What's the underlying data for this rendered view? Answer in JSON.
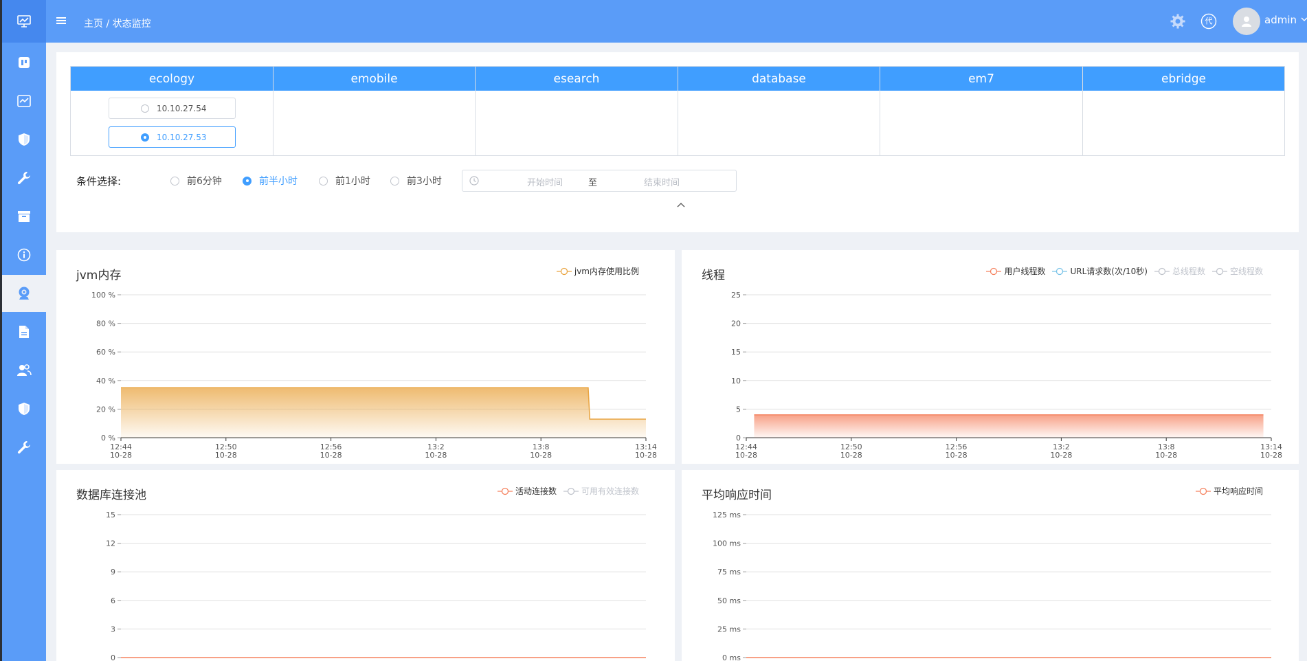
{
  "header": {
    "breadcrumb": "主页 / 状态监控",
    "username": "admin",
    "proxy_icon_text": "代"
  },
  "sidebar": {
    "items": [
      "monitor-icon",
      "board-icon",
      "chart-icon",
      "shield-icon",
      "wrench-icon",
      "archive-icon",
      "info-icon",
      "webcam-icon",
      "document-icon",
      "users-icon",
      "shield-icon",
      "wrench-icon"
    ],
    "active_index": 7
  },
  "servers": {
    "tabs": [
      "ecology",
      "emobile",
      "esearch",
      "database",
      "em7",
      "ebridge"
    ],
    "ecology_ips": [
      "10.10.27.54",
      "10.10.27.53"
    ],
    "selected_ip": "10.10.27.53"
  },
  "filter": {
    "label": "条件选择:",
    "options": [
      "前6分钟",
      "前半小时",
      "前1小时",
      "前3小时"
    ],
    "selected": "前半小时",
    "start_placeholder": "开始时间",
    "range_separator": "至",
    "end_placeholder": "结束时间"
  },
  "colors": {
    "primary": "#409eff",
    "header": "#5a9cf8",
    "jvm": "#e9a440",
    "user_threads": "#f5825f",
    "url_requests": "#79c3e8"
  },
  "chart_data": [
    {
      "id": "jvm",
      "title": "jvm内存",
      "type": "area",
      "x": [
        "12:44\n10-28",
        "12:50\n10-28",
        "12:56\n10-28",
        "13:2\n10-28",
        "13:8\n10-28",
        "13:14\n10-28"
      ],
      "yticks": [
        "100 %",
        "80 %",
        "60 %",
        "40 %",
        "20 %",
        "0 %"
      ],
      "ylim": [
        0,
        100
      ],
      "series": [
        {
          "name": "jvm内存使用比例",
          "color": "#e9a440",
          "active": true,
          "points": [
            [
              0,
              35
            ],
            [
              0.89,
              35
            ],
            [
              0.893,
              13
            ],
            [
              1,
              13
            ]
          ]
        }
      ]
    },
    {
      "id": "threads",
      "title": "线程",
      "type": "area",
      "x": [
        "12:44\n10-28",
        "12:50\n10-28",
        "12:56\n10-28",
        "13:2\n10-28",
        "13:8\n10-28",
        "13:14\n10-28"
      ],
      "yticks": [
        "25",
        "20",
        "15",
        "10",
        "5",
        "0"
      ],
      "ylim": [
        0,
        25
      ],
      "series": [
        {
          "name": "用户线程数",
          "color": "#f5825f",
          "active": true,
          "points": [
            [
              0.015,
              4
            ],
            [
              0.985,
              4
            ]
          ]
        },
        {
          "name": "URL请求数(次/10秒)",
          "color": "#79c3e8",
          "active": true,
          "points": []
        },
        {
          "name": "总线程数",
          "color": "#c0c4cc",
          "active": false,
          "points": []
        },
        {
          "name": "空线程数",
          "color": "#c0c4cc",
          "active": false,
          "points": []
        }
      ]
    },
    {
      "id": "dbpool",
      "title": "数据库连接池",
      "type": "line",
      "x": [],
      "yticks": [
        "15",
        "12",
        "9",
        "6",
        "3",
        "0"
      ],
      "ylim": [
        0,
        15
      ],
      "series": [
        {
          "name": "活动连接数",
          "color": "#f5825f",
          "active": true,
          "points": [
            [
              0,
              0
            ],
            [
              1,
              0
            ]
          ]
        },
        {
          "name": "可用有效连接数",
          "color": "#c0c4cc",
          "active": false,
          "points": []
        }
      ]
    },
    {
      "id": "response",
      "title": "平均响应时间",
      "type": "line",
      "x": [],
      "yticks": [
        "125 ms",
        "100 ms",
        "75 ms",
        "50 ms",
        "25 ms",
        "0 ms"
      ],
      "ylim": [
        0,
        125
      ],
      "series": [
        {
          "name": "平均响应时间",
          "color": "#f5825f",
          "active": true,
          "points": [
            [
              0,
              0
            ],
            [
              1,
              0
            ]
          ]
        }
      ]
    }
  ]
}
